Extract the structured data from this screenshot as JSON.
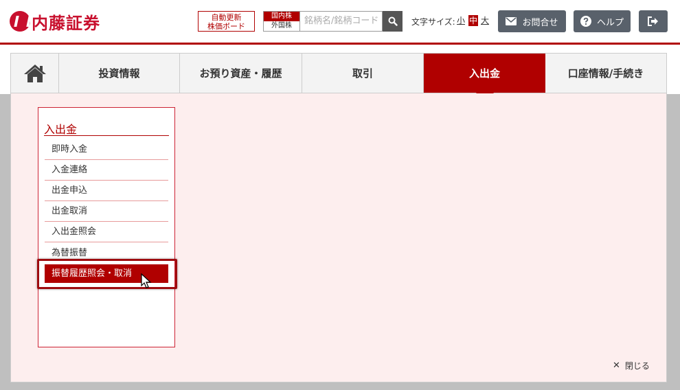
{
  "header": {
    "logo_text": "内藤証券",
    "board_button_line1": "自動更新",
    "board_button_line2": "株価ボード",
    "market_domestic": "国内株",
    "market_foreign": "外国株",
    "search_placeholder": "銘柄名/銘柄コード",
    "font_size_label": "文字サイズ:",
    "font_size_small": "小",
    "font_size_medium": "中",
    "font_size_large": "大",
    "contact_label": "お問合せ",
    "help_label": "ヘルプ"
  },
  "nav": {
    "tabs": [
      {
        "label": "投資情報"
      },
      {
        "label": "お預り資産・履歴"
      },
      {
        "label": "取引"
      },
      {
        "label": "入出金"
      },
      {
        "label": "口座情報/手続き"
      }
    ],
    "active_tab": "入出金"
  },
  "menu": {
    "title": "入出金",
    "items": [
      {
        "label": "即時入金"
      },
      {
        "label": "入金連絡"
      },
      {
        "label": "出金申込"
      },
      {
        "label": "出金取消"
      },
      {
        "label": "入出金照会"
      },
      {
        "label": "為替振替"
      },
      {
        "label": "振替履歴照会・取消"
      }
    ],
    "selected_item": "振替履歴照会・取消"
  },
  "close_label": "閉じる",
  "colors": {
    "brand_red": "#b00000",
    "panel_bg": "#fdeeee",
    "button_gray": "#59616b"
  }
}
